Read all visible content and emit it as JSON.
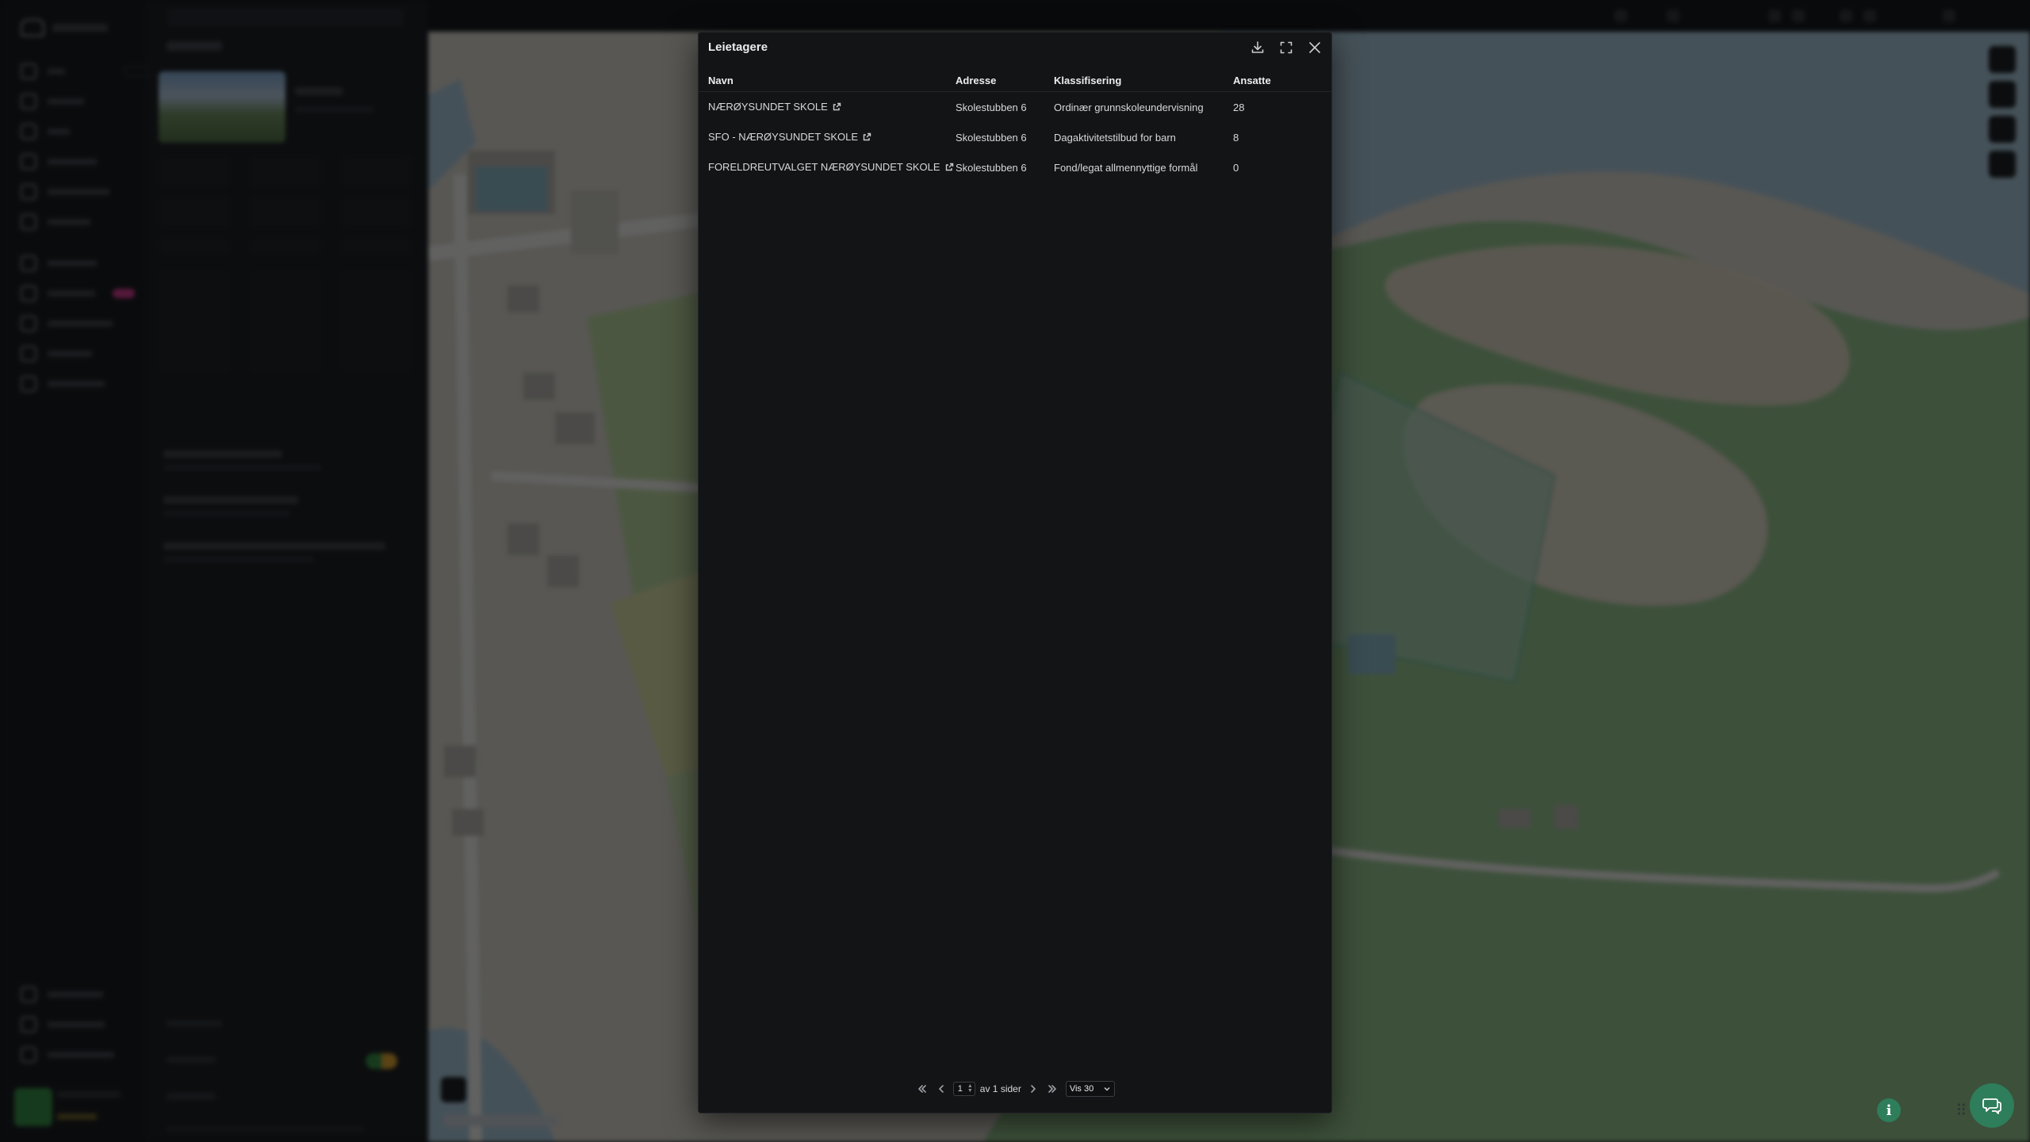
{
  "modal": {
    "title": "Leietagere",
    "columns": {
      "name": "Navn",
      "address": "Adresse",
      "classification": "Klassifisering",
      "employees": "Ansatte"
    },
    "rows": [
      {
        "name": "NÆRØYSUNDET SKOLE",
        "address": "Skolestubben 6",
        "classification": "Ordinær grunnskoleundervisning",
        "employees": "28"
      },
      {
        "name": "SFO - NÆRØYSUNDET SKOLE",
        "address": "Skolestubben 6",
        "classification": "Dagaktivitetstilbud for barn",
        "employees": "8"
      },
      {
        "name": "FORELDREUTVALGET NÆRØYSUNDET SKOLE",
        "address": "Skolestubben 6",
        "classification": "Fond/legat allmennyttige formål",
        "employees": "0"
      }
    ],
    "pagination": {
      "current_page": "1",
      "of_pages_text": "av 1 sider",
      "page_size_label": "Vis 30"
    }
  },
  "icons": {
    "download": "download-icon",
    "expand": "expand-icon",
    "close": "close-icon",
    "external_link": "external-link-icon",
    "first_page": "chevrons-left-icon",
    "prev_page": "chevron-left-icon",
    "next_page": "chevron-right-icon",
    "last_page": "chevrons-right-icon",
    "info": "info-icon",
    "chat": "chat-icon"
  },
  "colors": {
    "modal_bg": "#131416",
    "accent_green": "#2e7d5b",
    "badge_pink": "#d6338a"
  }
}
